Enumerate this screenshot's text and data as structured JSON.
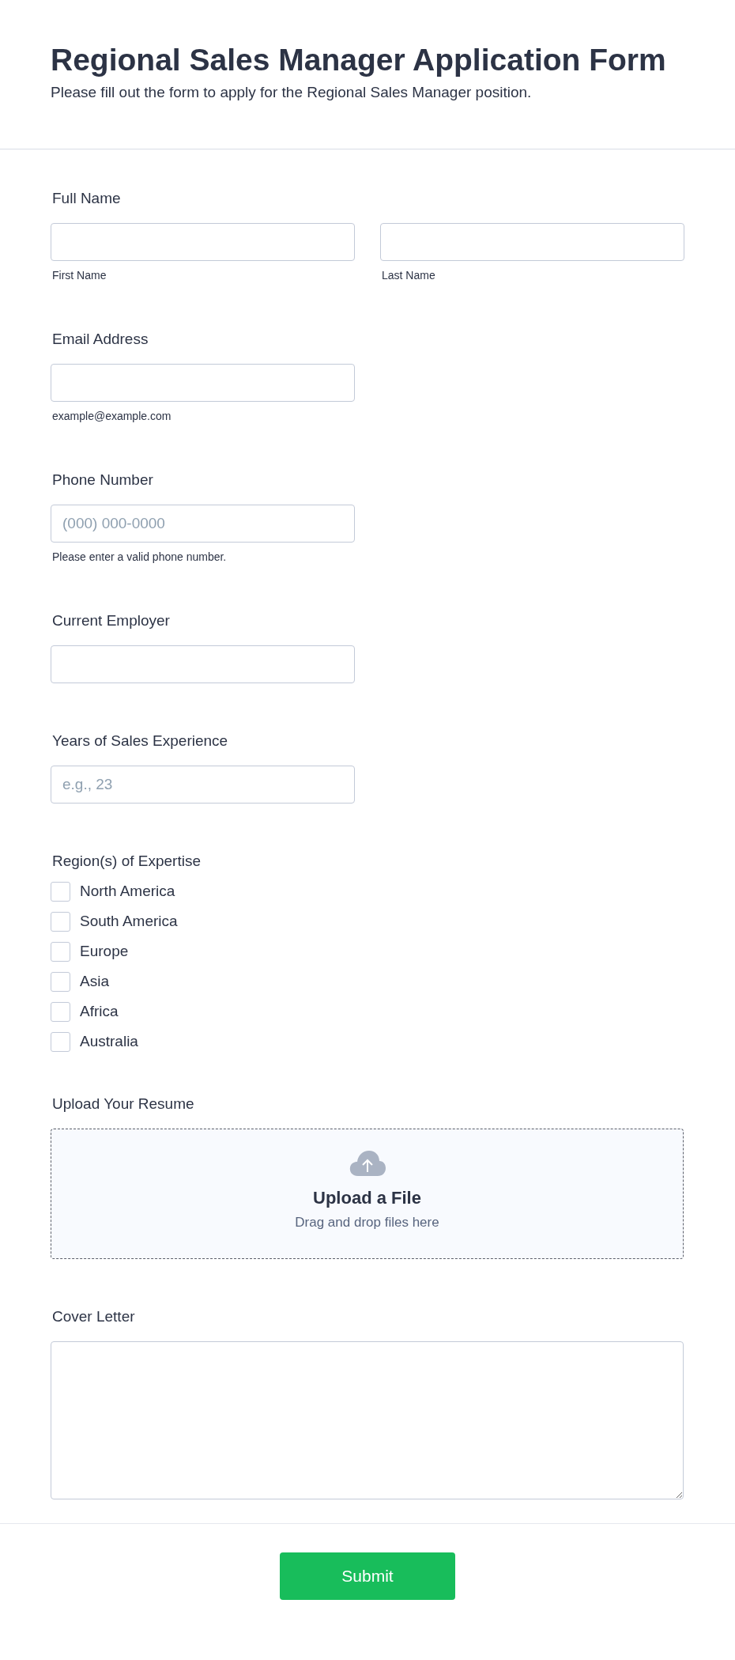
{
  "header": {
    "title": "Regional Sales Manager Application Form",
    "subtitle": "Please fill out the form to apply for the Regional Sales Manager position."
  },
  "fields": [
    {
      "kind": "name",
      "label": "Full Name",
      "inputs": [
        {
          "sublabel": "First Name"
        },
        {
          "sublabel": "Last Name"
        }
      ]
    },
    {
      "kind": "text",
      "label": "Email Address",
      "sublabel": "example@example.com"
    },
    {
      "kind": "text",
      "label": "Phone Number",
      "placeholder": "(000) 000-0000",
      "sublabel": "Please enter a valid phone number."
    },
    {
      "kind": "text",
      "label": "Current Employer"
    },
    {
      "kind": "text",
      "label": "Years of Sales Experience",
      "placeholder": "e.g., 23"
    },
    {
      "kind": "checkboxes",
      "label": "Region(s) of Expertise",
      "options": [
        {
          "label": "North America",
          "checked": false
        },
        {
          "label": "South America",
          "checked": false
        },
        {
          "label": "Europe",
          "checked": false
        },
        {
          "label": "Asia",
          "checked": false
        },
        {
          "label": "Africa",
          "checked": false
        },
        {
          "label": "Australia",
          "checked": false
        }
      ]
    },
    {
      "kind": "upload",
      "label": "Upload Your Resume",
      "title": "Upload a File",
      "hint": "Drag and drop files here"
    },
    {
      "kind": "textarea",
      "label": "Cover Letter"
    }
  ],
  "submit": "Submit"
}
